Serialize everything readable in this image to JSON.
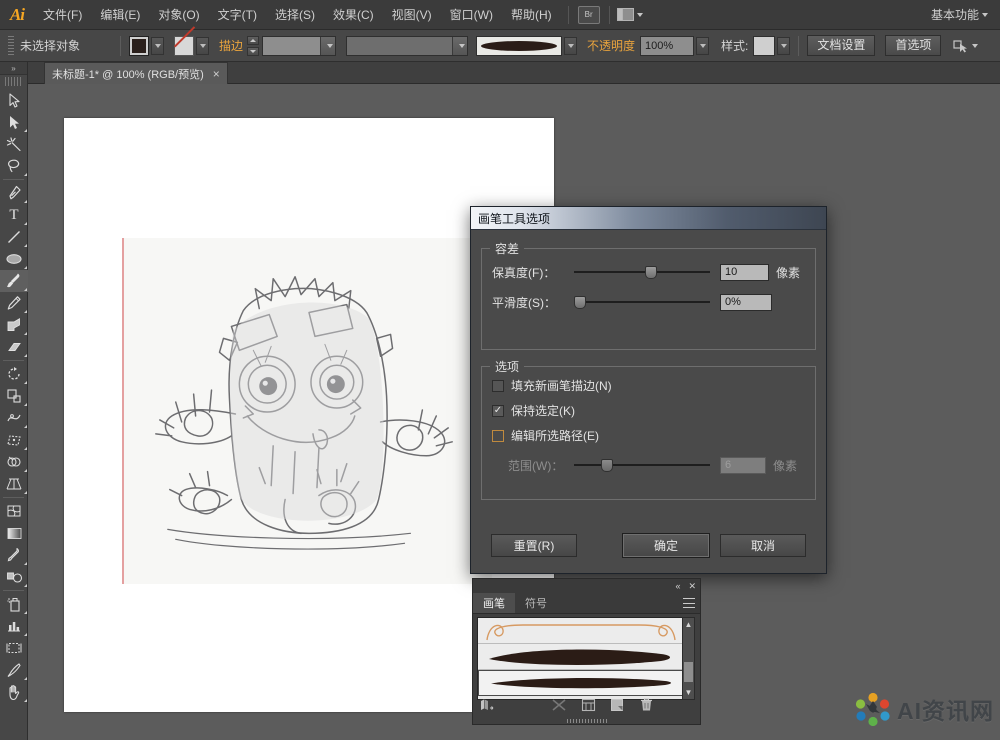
{
  "app": {
    "logo": "Ai",
    "workspace": "基本功能"
  },
  "menubar": {
    "items": [
      {
        "label": "文件(F)"
      },
      {
        "label": "编辑(E)"
      },
      {
        "label": "对象(O)"
      },
      {
        "label": "文字(T)"
      },
      {
        "label": "选择(S)"
      },
      {
        "label": "效果(C)"
      },
      {
        "label": "视图(V)"
      },
      {
        "label": "窗口(W)"
      },
      {
        "label": "帮助(H)"
      }
    ],
    "bridge_label": "Br"
  },
  "optionsbar": {
    "selection_status": "未选择对象",
    "fill_color": "#2b201c",
    "stroke_label": "描边",
    "stroke_weight": "",
    "stroke_profile": "",
    "opacity_label": "不透明度",
    "opacity_value": "100%",
    "style_label": "样式:",
    "document_setup": "文档设置",
    "preferences": "首选项"
  },
  "documenttab": {
    "title": "未标题-1* @ 100% (RGB/预览)",
    "close": "×"
  },
  "toolbar": {
    "tools": [
      {
        "name": "selection-tool",
        "active": false
      },
      {
        "name": "direct-selection-tool",
        "active": false
      },
      {
        "name": "magic-wand-tool",
        "active": false
      },
      {
        "name": "lasso-tool",
        "active": false
      },
      {
        "name": "pen-tool",
        "active": false
      },
      {
        "name": "type-tool",
        "active": false
      },
      {
        "name": "line-segment-tool",
        "active": false
      },
      {
        "name": "ellipse-tool",
        "active": false
      },
      {
        "name": "paintbrush-tool",
        "active": true
      },
      {
        "name": "pencil-tool",
        "active": false
      },
      {
        "name": "blob-brush-tool",
        "active": false
      },
      {
        "name": "eraser-tool",
        "active": false
      },
      {
        "name": "rotate-tool",
        "active": false
      },
      {
        "name": "scale-tool",
        "active": false
      },
      {
        "name": "width-tool",
        "active": false
      },
      {
        "name": "free-transform-tool",
        "active": false
      },
      {
        "name": "shape-builder-tool",
        "active": false
      },
      {
        "name": "perspective-grid-tool",
        "active": false
      },
      {
        "name": "mesh-tool",
        "active": false
      },
      {
        "name": "gradient-tool",
        "active": false
      },
      {
        "name": "eyedropper-tool",
        "active": false
      },
      {
        "name": "blend-tool",
        "active": false
      },
      {
        "name": "symbol-sprayer-tool",
        "active": false
      },
      {
        "name": "column-graph-tool",
        "active": false
      },
      {
        "name": "artboard-tool",
        "active": false
      },
      {
        "name": "slice-tool",
        "active": false
      },
      {
        "name": "hand-tool",
        "active": false
      }
    ]
  },
  "dialog": {
    "title": "画笔工具选项",
    "tolerance": {
      "legend": "容差",
      "fidelity": {
        "label": "保真度(F)：",
        "value": "10",
        "unit": "像素",
        "thumb_percent": 40
      },
      "smoothness": {
        "label": "平滑度(S)：",
        "value": "0%",
        "unit": "",
        "thumb_percent": 0
      }
    },
    "options": {
      "legend": "选项",
      "checkboxes": [
        {
          "label": "填充新画笔描边(N)",
          "checked": false,
          "focused": false
        },
        {
          "label": "保持选定(K)",
          "checked": true,
          "focused": false
        },
        {
          "label": "编辑所选路径(E)",
          "checked": false,
          "focused": true
        }
      ],
      "range": {
        "label": "范围(W)：",
        "value": "6",
        "unit": "像素",
        "thumb_percent": 20,
        "disabled": true
      }
    },
    "buttons": {
      "reset": "重置(R)",
      "ok": "确定",
      "cancel": "取消"
    }
  },
  "brushes_panel": {
    "tabs": [
      {
        "label": "画笔",
        "selected": true
      },
      {
        "label": "符号",
        "selected": false
      }
    ],
    "items": [
      {
        "name": "brush-basic-calligraphic",
        "selected": false
      },
      {
        "name": "brush-tapered-thick",
        "selected": false
      },
      {
        "name": "brush-tapered-thin",
        "selected": true
      }
    ],
    "footer_icons": [
      {
        "name": "brush-libraries-icon"
      },
      {
        "name": "remove-brush-stroke-icon"
      },
      {
        "name": "options-of-selected-object-icon"
      },
      {
        "name": "new-brush-icon"
      },
      {
        "name": "delete-brush-icon"
      }
    ]
  },
  "watermark": {
    "text": "AI资讯网"
  }
}
